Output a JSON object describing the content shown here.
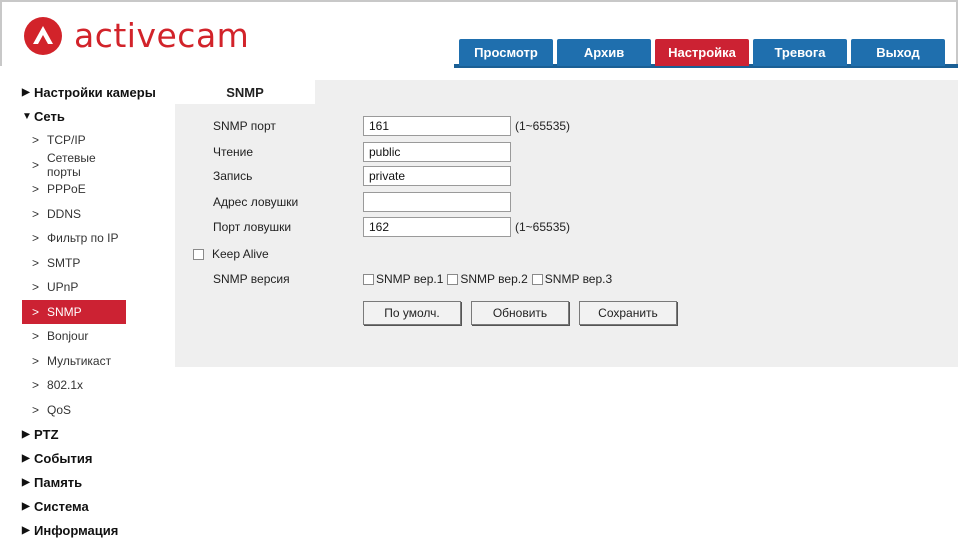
{
  "brand": {
    "name": "activecam",
    "color": "#d2232a"
  },
  "nav": {
    "tabs": [
      {
        "label": "Просмотр",
        "active": false
      },
      {
        "label": "Архив",
        "active": false
      },
      {
        "label": "Настройка",
        "active": true
      },
      {
        "label": "Тревога",
        "active": false
      },
      {
        "label": "Выход",
        "active": false
      }
    ]
  },
  "sidebar": {
    "sections": [
      {
        "label": "Настройки камеры",
        "expanded": false
      },
      {
        "label": "Сеть",
        "expanded": true,
        "items": [
          "TCP/IP",
          "Сетевые порты",
          "PPPoE",
          "DDNS",
          "Фильтр по IP",
          "SMTP",
          "UPnP",
          "SNMP",
          "Bonjour",
          "Мультикаст",
          "802.1x",
          "QoS"
        ],
        "active_item": "SNMP"
      },
      {
        "label": "PTZ",
        "expanded": false
      },
      {
        "label": "События",
        "expanded": false
      },
      {
        "label": "Память",
        "expanded": false
      },
      {
        "label": "Система",
        "expanded": false
      },
      {
        "label": "Информация",
        "expanded": false
      }
    ]
  },
  "content": {
    "tab": "SNMP",
    "fields": {
      "snmp_port": {
        "label": "SNMP порт",
        "value": "161",
        "range": "(1~65535)"
      },
      "read": {
        "label": "Чтение",
        "value": "public"
      },
      "write": {
        "label": "Запись",
        "value": "private"
      },
      "trap_address": {
        "label": "Адрес ловушки",
        "value": ""
      },
      "trap_port": {
        "label": "Порт ловушки",
        "value": "162",
        "range": "(1~65535)"
      }
    },
    "keep_alive": {
      "label": "Keep Alive",
      "checked": false
    },
    "versions": {
      "label": "SNMP версия",
      "options": [
        {
          "label": "SNMP вер.1",
          "checked": false
        },
        {
          "label": "SNMP вер.2",
          "checked": false
        },
        {
          "label": "SNMP вер.3",
          "checked": false
        }
      ]
    },
    "buttons": {
      "default": "По умолч.",
      "refresh": "Обновить",
      "save": "Сохранить"
    }
  },
  "colors": {
    "nav_blue": "#1f6fae",
    "active_red": "#cc2233",
    "panel_gray": "#efefef"
  }
}
